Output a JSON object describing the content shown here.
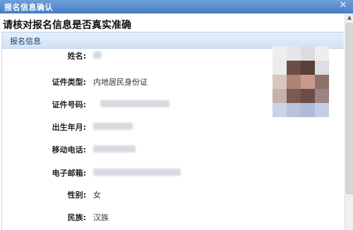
{
  "window": {
    "title": "报名信息确认",
    "close_glyph": "✕"
  },
  "heading": "请核对报名信息是否真实准确",
  "section": {
    "title": "报名信息"
  },
  "fields": [
    {
      "label": "姓名:",
      "value": ""
    },
    {
      "label": "证件类型:",
      "value": "内地居民身份证"
    },
    {
      "label": "证件号码:",
      "value": ""
    },
    {
      "label": "出生年月:",
      "value": ""
    },
    {
      "label": "移动电话:",
      "value": ""
    },
    {
      "label": "电子邮箱:",
      "value": ""
    },
    {
      "label": "性别:",
      "value": "女"
    },
    {
      "label": "民族:",
      "value": "汉族"
    }
  ],
  "visible_fragments": {
    "name_tail": "",
    "scroll_up_glyph": "▲"
  },
  "colors": {
    "titlebar": "#4a80c8",
    "section_header": "#dce8f6",
    "section_text": "#1a3f6e"
  }
}
